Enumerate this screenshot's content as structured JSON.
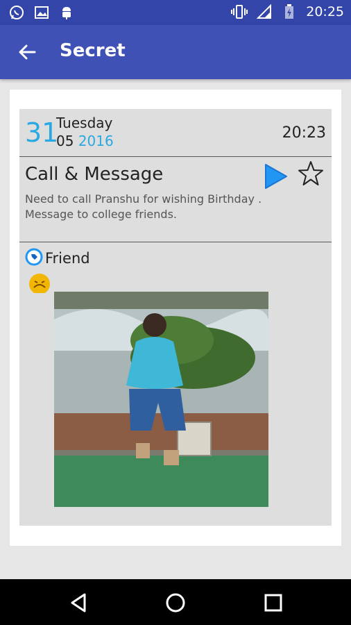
{
  "status_bar": {
    "time": "20:25"
  },
  "app_bar": {
    "title": "Secret"
  },
  "note": {
    "day": "31",
    "weekday": "Tuesday",
    "month": "05",
    "year": "2016",
    "time": "20:23",
    "title": "Call & Message",
    "body": "Need to call Pranshu for wishing Birthday .\nMessage to college friends.",
    "tag": "Friend",
    "mood_icon": "sad-emoji-icon",
    "photo": "photo-thumbnail"
  },
  "colors": {
    "primary": "#3f51b5",
    "status_bar": "#3345a8",
    "accent": "#29a9e1"
  }
}
